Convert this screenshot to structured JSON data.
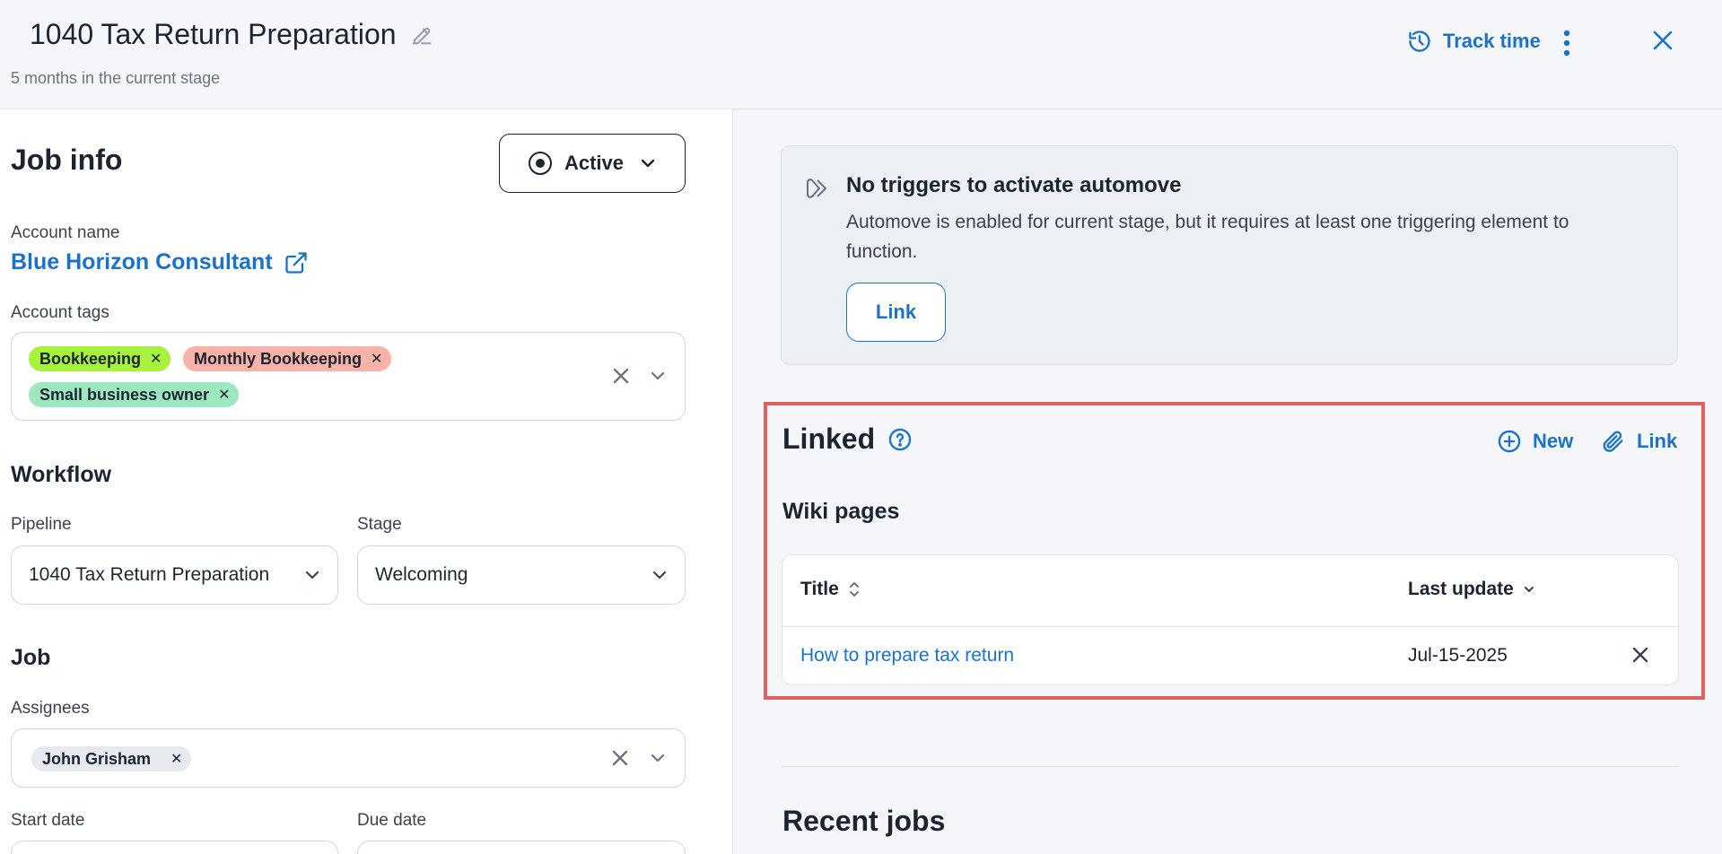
{
  "header": {
    "title": "1040 Tax Return Preparation",
    "subtitle": "5 months in the current stage",
    "track_time_label": "Track time"
  },
  "job_info": {
    "heading": "Job info",
    "status_label": "Active",
    "account_name_label": "Account name",
    "account_name": "Blue Horizon Consultant",
    "account_tags_label": "Account tags",
    "tags": [
      {
        "label": "Bookkeeping",
        "color": "#a6f23c"
      },
      {
        "label": "Monthly Bookkeeping",
        "color": "#f7b3a8"
      },
      {
        "label": "Small business owner",
        "color": "#9ee8c0"
      }
    ]
  },
  "workflow": {
    "heading": "Workflow",
    "pipeline_label": "Pipeline",
    "pipeline_value": "1040 Tax Return Preparation",
    "stage_label": "Stage",
    "stage_value": "Welcoming"
  },
  "job": {
    "heading": "Job",
    "assignees_label": "Assignees",
    "assignees": [
      "John Grisham"
    ],
    "start_date_label": "Start date",
    "due_date_label": "Due date"
  },
  "automove": {
    "title": "No triggers to activate automove",
    "body": "Automove is enabled for current stage, but it requires at least one triggering element to function.",
    "link_label": "Link"
  },
  "linked": {
    "title": "Linked",
    "new_label": "New",
    "link_label": "Link",
    "wiki_heading": "Wiki pages",
    "columns": [
      "Title",
      "Last update"
    ],
    "rows": [
      {
        "title": "How to prepare tax return",
        "last_update": "Jul-15-2025"
      }
    ]
  },
  "recent_jobs": {
    "heading": "Recent jobs"
  },
  "colors": {
    "accent": "#1a72c9",
    "highlight_frame": "#e06160",
    "text": "#1d2431"
  }
}
